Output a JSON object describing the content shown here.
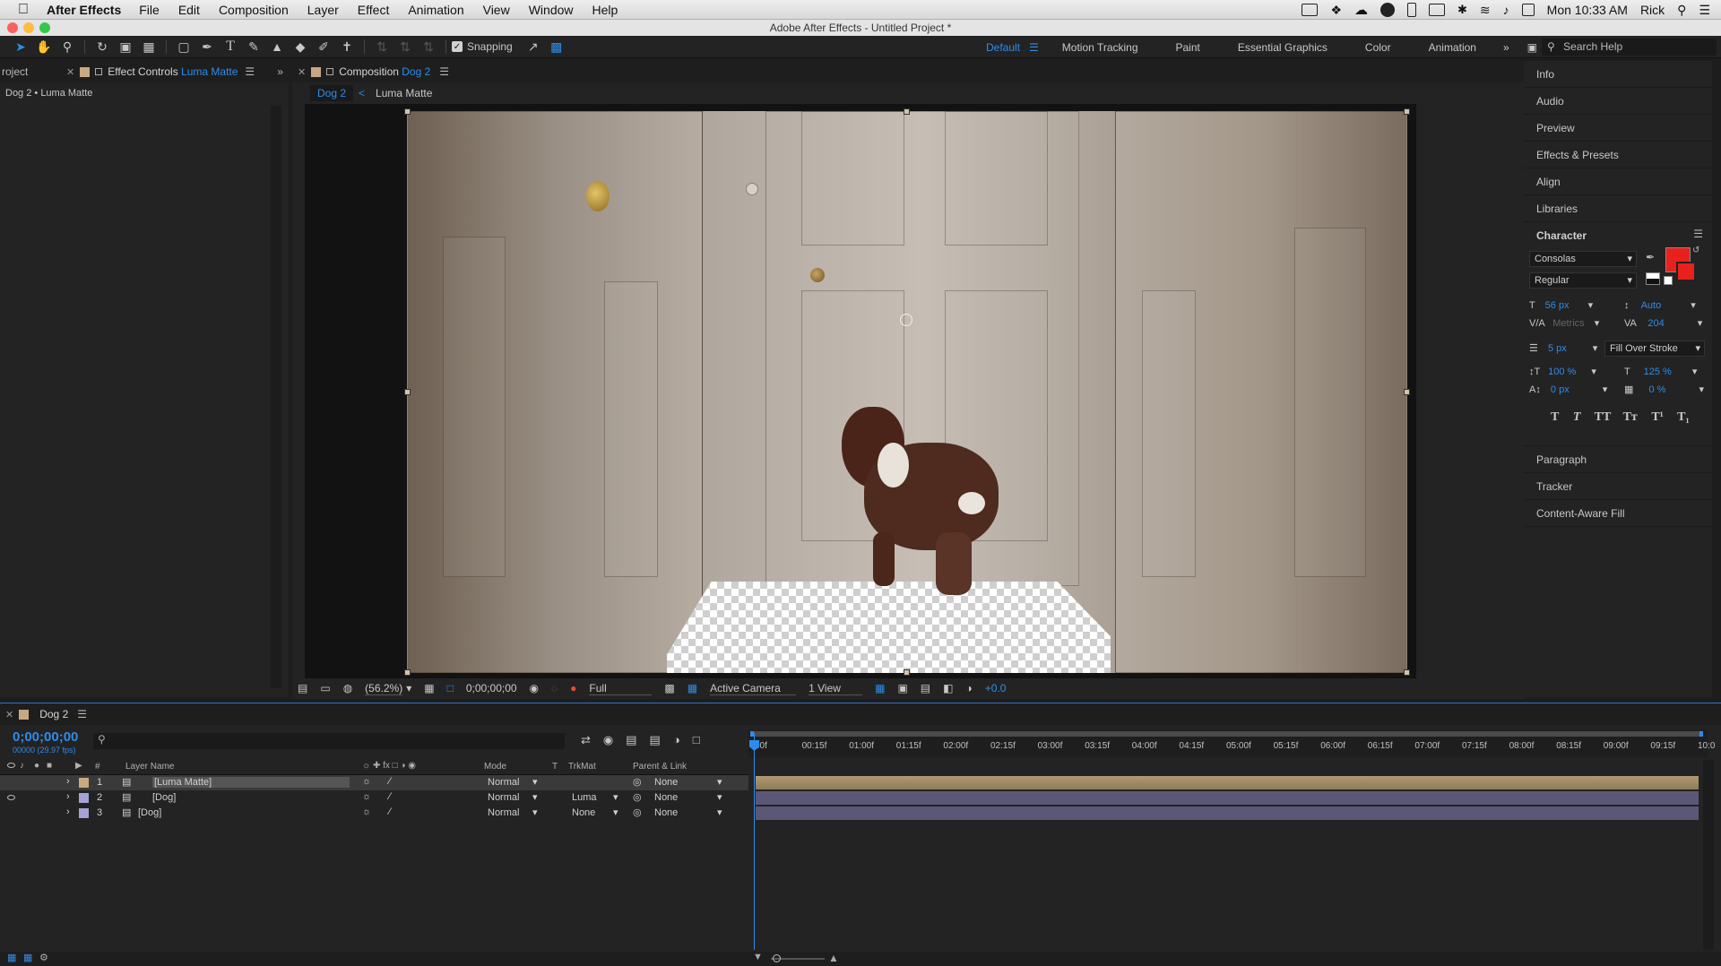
{
  "menubar": {
    "app_name": "After Effects",
    "items": [
      "File",
      "Edit",
      "Composition",
      "Layer",
      "Effect",
      "Animation",
      "View",
      "Window",
      "Help"
    ],
    "clock": "Mon 10:33 AM",
    "user": "Rick"
  },
  "window": {
    "title": "Adobe After Effects - Untitled Project *"
  },
  "toolbar": {
    "snapping_label": "Snapping",
    "snapping_checked": true,
    "workspaces": [
      "Default",
      "Motion Tracking",
      "Paint",
      "Essential Graphics",
      "Color",
      "Animation"
    ],
    "active_workspace": "Default",
    "search_placeholder": "Search Help"
  },
  "project_panel": {
    "tab_label": "roject",
    "effect_controls_prefix": "Effect Controls",
    "effect_controls_layer": "Luma Matte",
    "breadcrumb": "Dog 2 • Luma Matte"
  },
  "composition_panel": {
    "tab_prefix": "Composition",
    "tab_comp": "Dog 2",
    "flow": [
      "Dog 2",
      "Luma Matte"
    ],
    "footer": {
      "zoom": "(56.2%)",
      "timecode": "0;00;00;00",
      "resolution": "Full",
      "camera": "Active Camera",
      "views": "1 View",
      "exposure": "+0.0"
    }
  },
  "right_panel": {
    "items_top": [
      "Info",
      "Audio",
      "Preview",
      "Effects & Presets",
      "Align",
      "Libraries"
    ],
    "character": {
      "title": "Character",
      "font": "Consolas",
      "style": "Regular",
      "size": "56 px",
      "leading": "Auto",
      "kerning": "Metrics",
      "tracking": "204",
      "stroke_width": "5 px",
      "stroke_type": "Fill Over Stroke",
      "vscale": "100 %",
      "hscale": "125 %",
      "baseline": "0 px",
      "tsume": "0 %",
      "fill_color": "#e8211d"
    },
    "items_bottom": [
      "Paragraph",
      "Tracker",
      "Content-Aware Fill"
    ]
  },
  "timeline": {
    "comp_tab": "Dog 2",
    "current_time": "0;00;00;00",
    "frame_info": "00000 (29.97 fps)",
    "columns": {
      "num": "#",
      "layer_name": "Layer Name",
      "mode": "Mode",
      "t": "T",
      "trkmat": "TrkMat",
      "parent": "Parent & Link"
    },
    "layers": [
      {
        "num": "1",
        "name": "[Luma Matte]",
        "mode": "Normal",
        "trkmat": "",
        "parent": "None",
        "color": "#c9a982",
        "selected": true
      },
      {
        "num": "2",
        "name": "[Dog]",
        "mode": "Normal",
        "trkmat": "Luma",
        "parent": "None",
        "color": "#a6a1d6",
        "selected": false
      },
      {
        "num": "3",
        "name": "[Dog]",
        "mode": "Normal",
        "trkmat": "None",
        "parent": "None",
        "color": "#a6a1d6",
        "selected": false
      }
    ],
    "ruler": [
      "00f",
      "00:15f",
      "01:00f",
      "01:15f",
      "02:00f",
      "02:15f",
      "03:00f",
      "03:15f",
      "04:00f",
      "04:15f",
      "05:00f",
      "05:15f",
      "06:00f",
      "06:15f",
      "07:00f",
      "07:15f",
      "08:00f",
      "08:15f",
      "09:00f",
      "09:15f",
      "10:0"
    ]
  }
}
